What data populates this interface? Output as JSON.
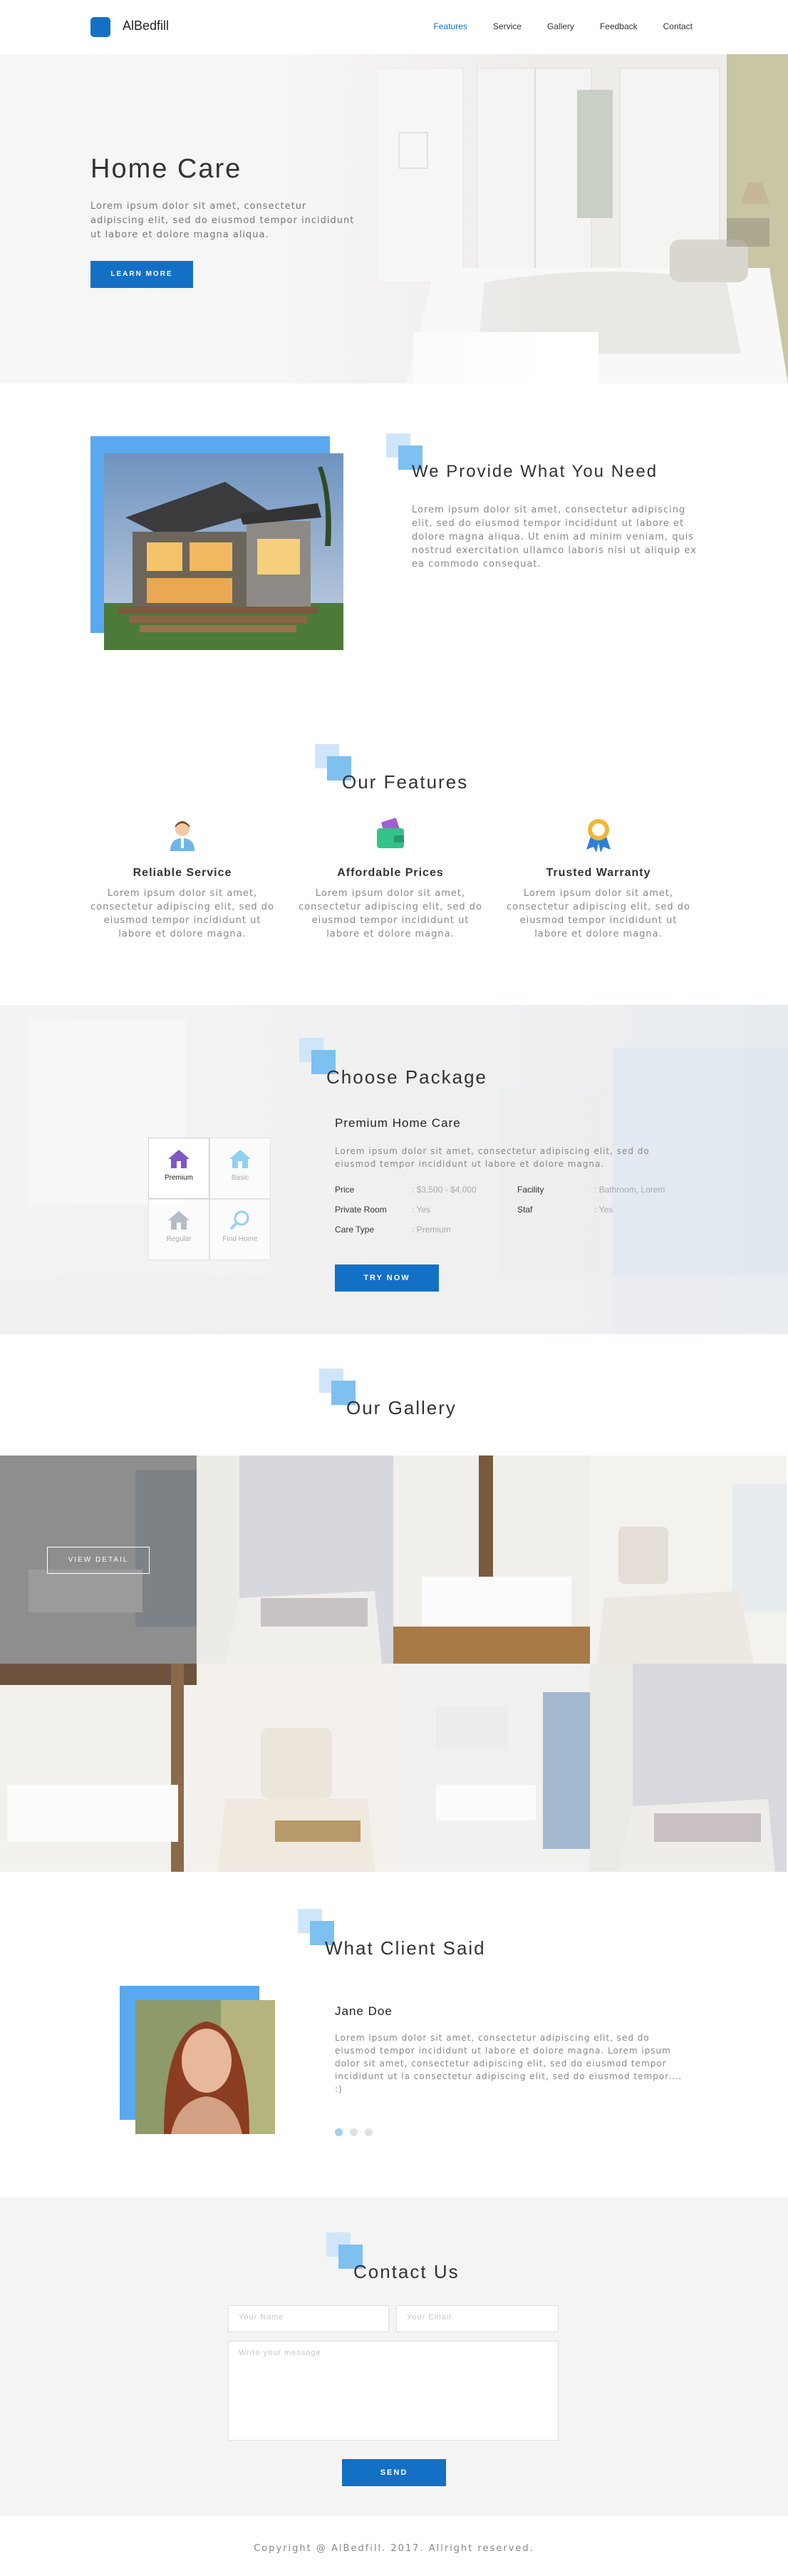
{
  "nav": {
    "brand": "AlBedfill",
    "links": [
      "Features",
      "Service",
      "Gallery",
      "Feedback",
      "Contact"
    ],
    "active": "Features",
    "brand_color": "#1470c5"
  },
  "hero": {
    "title": "Home Care",
    "text": "Lorem ipsum dolor sit amet, consectetur adipiscing elit, sed do eiusmod tempor incididunt ut labore et dolore magna aliqua.",
    "button": "LEARN MORE"
  },
  "provide": {
    "title": "We Provide What You Need",
    "text": "Lorem ipsum dolor sit amet, consectetur adipiscing elit, sed do eiusmod tempor incididunt ut labore et dolore magna aliqua. Ut enim ad minim veniam, quis nostrud exercitation ullamco laboris nisi ut aliquip ex ea commodo consequat."
  },
  "features": {
    "title": "Our Features",
    "items": [
      {
        "icon": "person-icon",
        "title": "Reliable Service",
        "text": "Lorem ipsum dolor sit amet, consectetur adipiscing elit, sed do eiusmod tempor incididunt ut labore et dolore magna."
      },
      {
        "icon": "wallet-icon",
        "title": "Affordable Prices",
        "text": "Lorem ipsum dolor sit amet, consectetur adipiscing elit, sed do eiusmod tempor incididunt ut labore et dolore magna."
      },
      {
        "icon": "award-icon",
        "title": "Trusted Warranty",
        "text": "Lorem ipsum dolor sit amet, consectetur adipiscing elit, sed do eiusmod tempor incididunt ut labore et dolore magna."
      }
    ]
  },
  "package": {
    "title": "Choose Package",
    "tiles": [
      "Premium",
      "Basic",
      "Regular",
      "Find Home"
    ],
    "selected": "Premium",
    "name": "Premium Home Care",
    "text": "Lorem ipsum dolor sit amet, consectetur adipiscing elit, sed do eiusmod tempor incididunt ut labore et dolore magna.",
    "rows": [
      {
        "label": "Price",
        "value": ": $3,500 - $4,000"
      },
      {
        "label": "Private Room",
        "value": ": Yes"
      },
      {
        "label": "Care Type",
        "value": ": Premium"
      },
      {
        "label": "Facility",
        "value": ": Bathroom, Lorem"
      },
      {
        "label": "Staf",
        "value": ": Yes"
      }
    ],
    "button": "TRY NOW"
  },
  "gallery": {
    "title": "Our Gallery",
    "overlay_button": "VIEW DETAIL"
  },
  "client": {
    "title": "What Client Said",
    "name": "Jane Doe",
    "text": "Lorem ipsum dolor sit amet, consectetur adipiscing elit, sed do eiusmod tempor incididunt ut labore et dolore magna. Lorem ipsum dolor sit amet, consectetur adipiscing elit, sed do eiusmod tempor incididunt ut la consectetur adipiscing elit, sed do eiusmod tempor.... :)",
    "dots": 3,
    "active_dot": 1
  },
  "contact": {
    "title": "Contact Us",
    "name_placeholder": "Your Name",
    "email_placeholder": "Your Email",
    "message_placeholder": "Write your message",
    "button": "SEND"
  },
  "footer": {
    "copyright": "Copyright @ AlBedfill. 2017. Allright reserved."
  }
}
